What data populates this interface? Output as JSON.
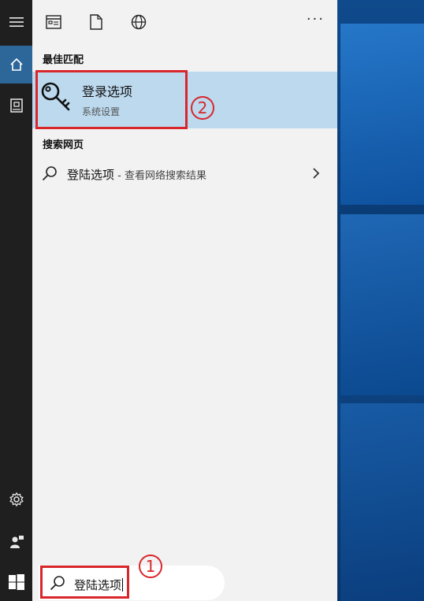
{
  "toolbar": {
    "more_label": "···"
  },
  "best_match": {
    "section_title": "最佳匹配",
    "title": "登录选项",
    "subtitle": "系统设置",
    "icon": "key-icon"
  },
  "web_search": {
    "section_title": "搜索网页",
    "query": "登陆选项",
    "suffix": " - 查看网络搜索结果"
  },
  "search_box": {
    "value": "登陆选项",
    "icon": "search-icon"
  },
  "annotations": {
    "marker_1": "1",
    "marker_2": "2",
    "color": "#d9262b"
  },
  "colors": {
    "highlight": "#bcd9ee",
    "rail": "#1f1f1f",
    "home_selected": "#2d6699"
  }
}
